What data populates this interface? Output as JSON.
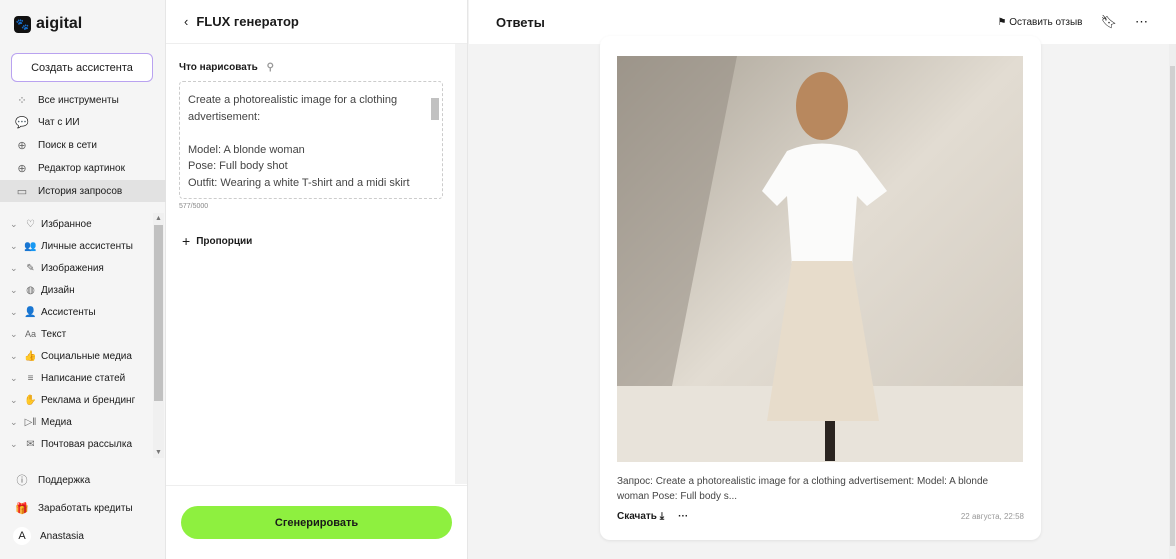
{
  "sidebar": {
    "logo": "aigital",
    "create_button": "Создать ассистента",
    "nav": [
      {
        "label": "Все инструменты",
        "icon": "grid-icon"
      },
      {
        "label": "Чат с ИИ",
        "icon": "chat-icon"
      },
      {
        "label": "Поиск в сети",
        "icon": "globe-icon"
      },
      {
        "label": "Редактор картинок",
        "icon": "globe-icon"
      },
      {
        "label": "История запросов",
        "icon": "folder-icon"
      }
    ],
    "categories": [
      {
        "label": "Избранное",
        "icon": "heart-icon"
      },
      {
        "label": "Личные ассистенты",
        "icon": "people-icon"
      },
      {
        "label": "Изображения",
        "icon": "brush-icon"
      },
      {
        "label": "Дизайн",
        "icon": "palette-icon"
      },
      {
        "label": "Ассистенты",
        "icon": "assistant-icon"
      },
      {
        "label": "Текст",
        "icon": "text-icon"
      },
      {
        "label": "Социальные медиа",
        "icon": "thumb-up-icon"
      },
      {
        "label": "Написание статей",
        "icon": "lines-icon"
      },
      {
        "label": "Реклама и брендинг",
        "icon": "hand-icon"
      },
      {
        "label": "Медиа",
        "icon": "play-pause-icon"
      },
      {
        "label": "Почтовая рассылка",
        "icon": "mail-icon"
      }
    ],
    "support": "Поддержка",
    "earn": "Заработать кредиты",
    "user": {
      "initial": "A",
      "name": "Anastasia"
    }
  },
  "generator": {
    "title": "FLUX генератор",
    "field_label": "Что нарисовать",
    "prompt": "Create a photorealistic image for a clothing advertisement:\n\nModel: A blonde woman\nPose: Full body shot\nOutfit: Wearing a white T-shirt and a midi skirt",
    "counter": "577/5000",
    "proportions": "Пропорции",
    "generate_button": "Сгенерировать",
    "accent": "#8ef03f"
  },
  "answers": {
    "title": "Ответы",
    "feedback": "Оставить отзыв",
    "result": {
      "query": "Запрос: Create a photorealistic image for a clothing advertisement: Model: A blonde woman Pose: Full body s...",
      "download": "Скачать",
      "date": "22 августа, 22:58"
    }
  }
}
